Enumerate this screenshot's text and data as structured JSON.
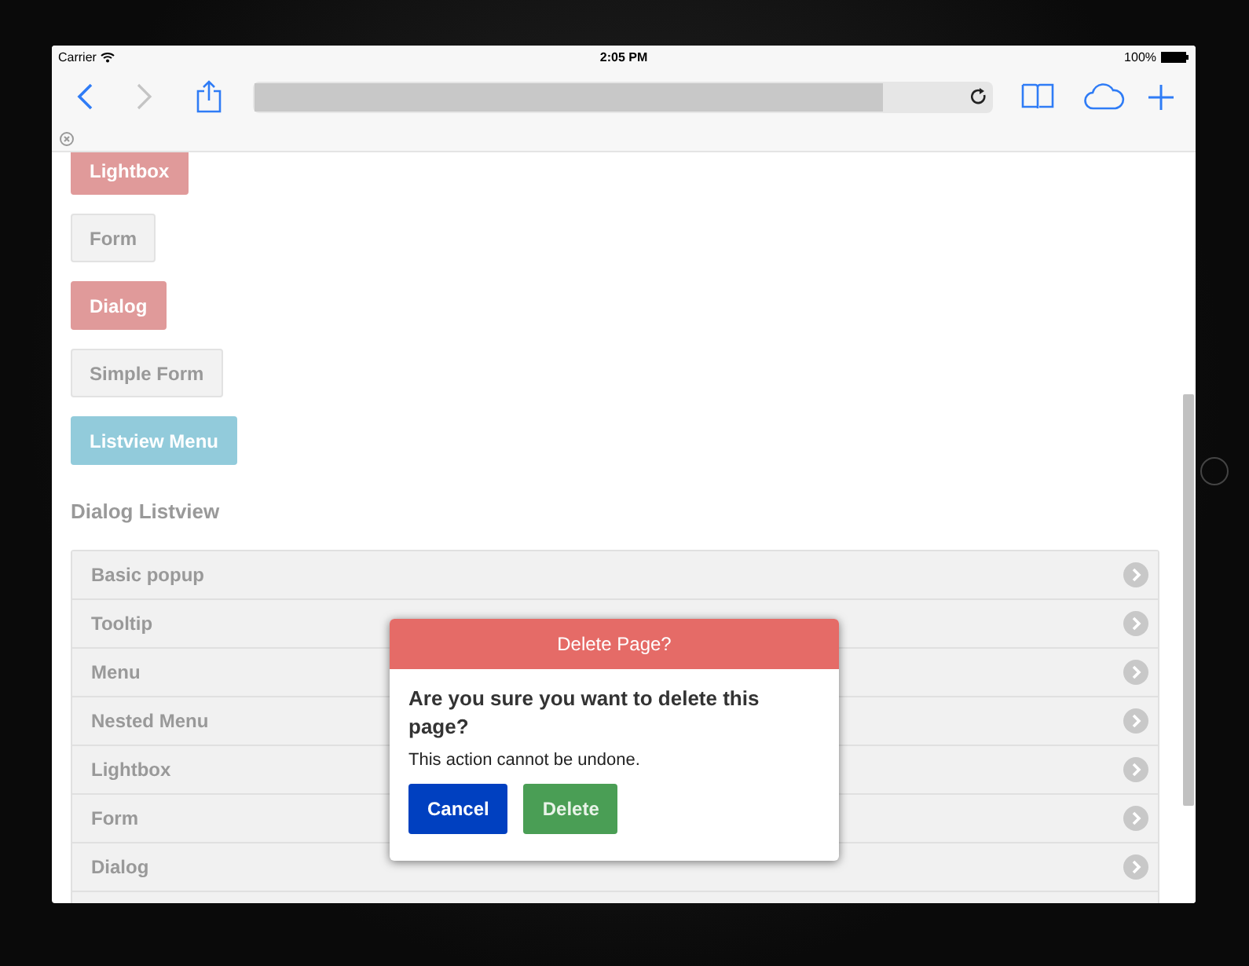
{
  "status_bar": {
    "carrier": "Carrier",
    "time": "2:05 PM",
    "battery": "100%"
  },
  "buttons": [
    {
      "label": "Lightbox",
      "kind": "danger"
    },
    {
      "label": "Form",
      "kind": "default"
    },
    {
      "label": "Dialog",
      "kind": "danger"
    },
    {
      "label": "Simple Form",
      "kind": "default"
    },
    {
      "label": "Listview Menu",
      "kind": "info"
    }
  ],
  "section_heading": "Dialog Listview",
  "list_items": [
    {
      "label": "Basic popup"
    },
    {
      "label": "Tooltip"
    },
    {
      "label": "Menu"
    },
    {
      "label": "Nested Menu"
    },
    {
      "label": "Lightbox"
    },
    {
      "label": "Form"
    },
    {
      "label": "Dialog"
    }
  ],
  "dialog": {
    "title": "Delete Page?",
    "question": "Are you sure you want to delete this page?",
    "message": "This action cannot be undone.",
    "actions": [
      {
        "label": "Cancel",
        "kind": "primary"
      },
      {
        "label": "Delete",
        "kind": "success"
      }
    ]
  }
}
